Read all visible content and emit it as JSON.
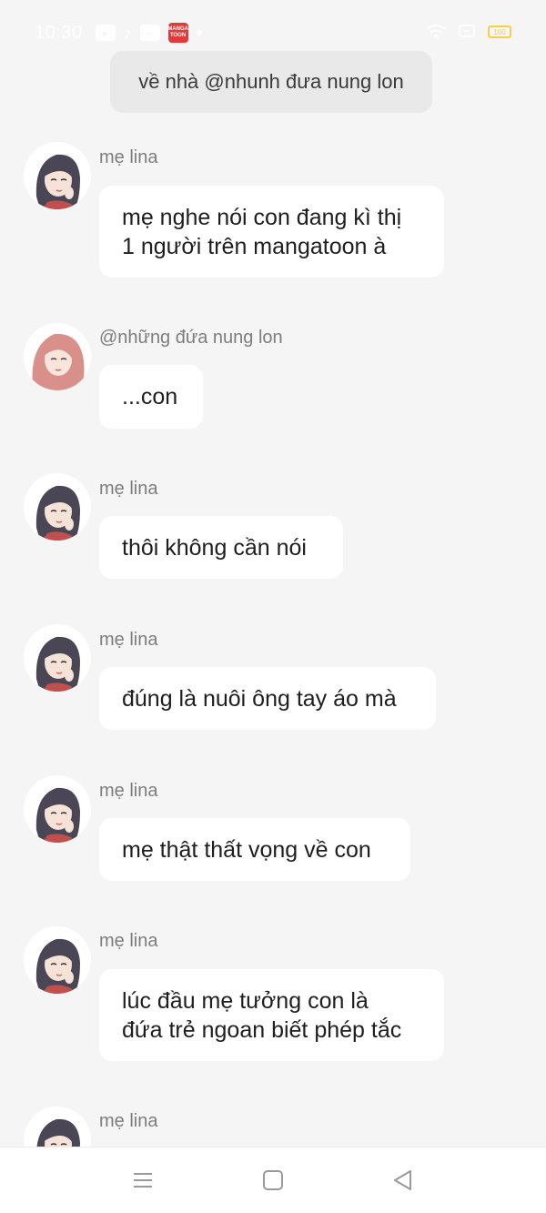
{
  "status_bar": {
    "time": "10:30",
    "manga_icon_label": "MANGA TOON",
    "battery": "100"
  },
  "system_message": "về nhà @nhunh đưa nung lon",
  "messages": [
    {
      "sender": "mẹ lina",
      "text": "mẹ nghe nói con đang kì thị\n1 người trên mangatoon à",
      "avatar": "mother-avatar"
    },
    {
      "sender": "@những đứa nung lon",
      "text": "...con",
      "avatar": "girl-avatar"
    },
    {
      "sender": "mẹ lina",
      "text": "thôi không cần nói",
      "avatar": "mother-avatar"
    },
    {
      "sender": "mẹ lina",
      "text": "đúng là nuôi ông tay áo mà",
      "avatar": "mother-avatar"
    },
    {
      "sender": "mẹ lina",
      "text": "mẹ thật thất vọng về con",
      "avatar": "mother-avatar"
    },
    {
      "sender": "mẹ lina",
      "text": "lúc đầu mẹ tưởng con là\nđứa trẻ ngoan biết phép tắc",
      "avatar": "mother-avatar"
    },
    {
      "sender": "mẹ lina",
      "text": "",
      "avatar": "mother-avatar"
    }
  ],
  "nav": {
    "menu_icon": "menu-icon",
    "home_icon": "home-square-icon",
    "back_icon": "back-triangle-icon"
  },
  "colors": {
    "background": "#f5f5f5",
    "bubble": "#ffffff",
    "system_bubble": "#e9e9e9",
    "sender_text": "#7d7d7d"
  }
}
